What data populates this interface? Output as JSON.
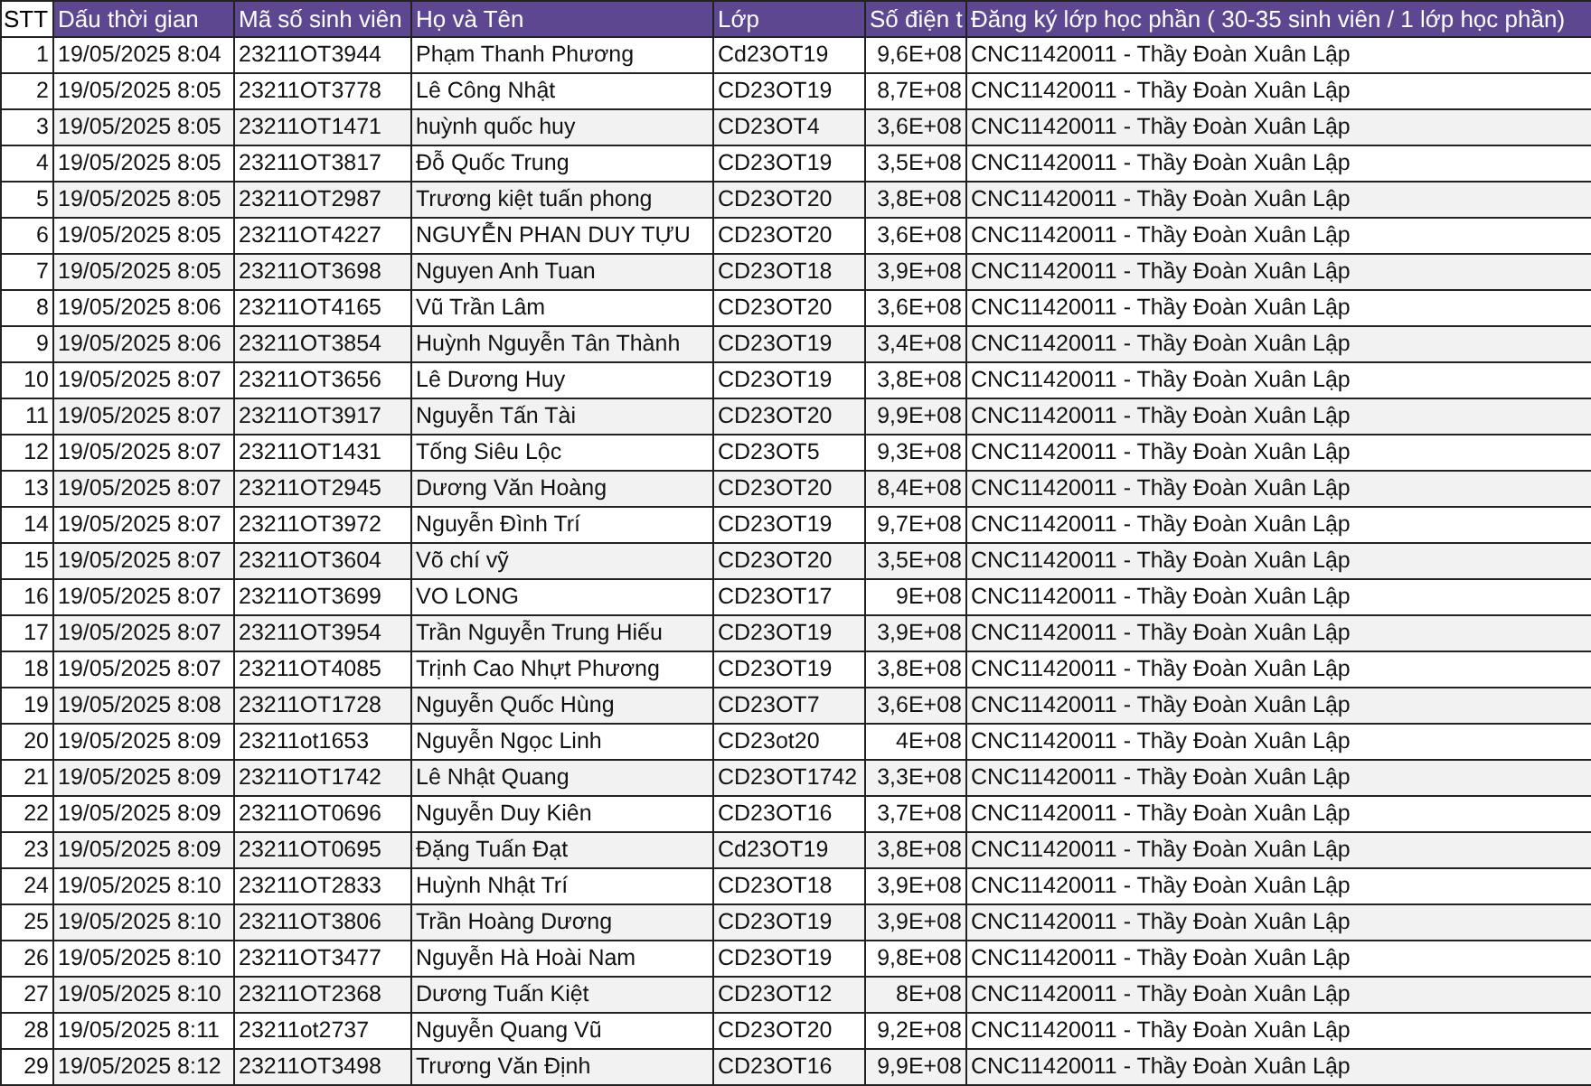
{
  "table": {
    "columns": [
      "STT",
      "Dấu thời gian",
      "Mã số sinh viên",
      "Họ và Tên",
      "Lớp",
      "Số điện t",
      "Đăng ký lớp học phần ( 30-35 sinh viên / 1 lớp học phần)"
    ],
    "rows": [
      [
        "1",
        "19/05/2025 8:04",
        "23211OT3944",
        "Phạm Thanh Phương",
        "Cd23OT19",
        "9,6E+08",
        "CNC11420011 - Thầy Đoàn Xuân Lập"
      ],
      [
        "2",
        "19/05/2025 8:05",
        "23211OT3778",
        "Lê Công Nhật",
        "CD23OT19",
        "8,7E+08",
        "CNC11420011 - Thầy Đoàn Xuân Lập"
      ],
      [
        "3",
        "19/05/2025 8:05",
        "23211OT1471",
        "huỳnh quốc huy",
        "CD23OT4",
        "3,6E+08",
        "CNC11420011 - Thầy Đoàn Xuân Lập"
      ],
      [
        "4",
        "19/05/2025 8:05",
        "23211OT3817",
        "Đỗ Quốc Trung",
        "CD23OT19",
        "3,5E+08",
        "CNC11420011 - Thầy Đoàn Xuân Lập"
      ],
      [
        "5",
        "19/05/2025 8:05",
        "23211OT2987",
        "Trương kiệt tuấn phong",
        "CD23OT20",
        "3,8E+08",
        "CNC11420011 - Thầy Đoàn Xuân Lập"
      ],
      [
        "6",
        "19/05/2025 8:05",
        "23211OT4227",
        "NGUYỄN PHAN DUY TỰU",
        "CD23OT20",
        "3,6E+08",
        "CNC11420011 - Thầy Đoàn Xuân Lập"
      ],
      [
        "7",
        "19/05/2025 8:05",
        "23211OT3698",
        "Nguyen Anh Tuan",
        "CD23OT18",
        "3,9E+08",
        "CNC11420011 - Thầy Đoàn Xuân Lập"
      ],
      [
        "8",
        "19/05/2025 8:06",
        "23211OT4165",
        "Vũ Trần Lâm",
        "CD23OT20",
        "3,6E+08",
        "CNC11420011 - Thầy Đoàn Xuân Lập"
      ],
      [
        "9",
        "19/05/2025 8:06",
        "23211OT3854",
        "Huỳnh Nguyễn Tân Thành",
        "CD23OT19",
        "3,4E+08",
        "CNC11420011 - Thầy Đoàn Xuân Lập"
      ],
      [
        "10",
        "19/05/2025 8:07",
        "23211OT3656",
        "Lê Dương Huy",
        "CD23OT19",
        "3,8E+08",
        "CNC11420011 - Thầy Đoàn Xuân Lập"
      ],
      [
        "11",
        "19/05/2025 8:07",
        "23211OT3917",
        "Nguyễn Tấn Tài",
        "CD23OT20",
        "9,9E+08",
        "CNC11420011 - Thầy Đoàn Xuân Lập"
      ],
      [
        "12",
        "19/05/2025 8:07",
        "23211OT1431",
        "Tống Siêu Lộc",
        "CD23OT5",
        "9,3E+08",
        "CNC11420011 - Thầy Đoàn Xuân Lập"
      ],
      [
        "13",
        "19/05/2025 8:07",
        "23211OT2945",
        "Dương Văn Hoàng",
        "CD23OT20",
        "8,4E+08",
        "CNC11420011 - Thầy Đoàn Xuân Lập"
      ],
      [
        "14",
        "19/05/2025 8:07",
        "23211OT3972",
        "Nguyễn Đình Trí",
        "CD23OT19",
        "9,7E+08",
        "CNC11420011 - Thầy Đoàn Xuân Lập"
      ],
      [
        "15",
        "19/05/2025 8:07",
        "23211OT3604",
        "Võ chí vỹ",
        "CD23OT20",
        "3,5E+08",
        "CNC11420011 - Thầy Đoàn Xuân Lập"
      ],
      [
        "16",
        "19/05/2025 8:07",
        "23211OT3699",
        "VO LONG",
        "CD23OT17",
        "9E+08",
        "CNC11420011 - Thầy Đoàn Xuân Lập"
      ],
      [
        "17",
        "19/05/2025 8:07",
        "23211OT3954",
        "Trần Nguyễn Trung Hiếu",
        "CD23OT19",
        "3,9E+08",
        "CNC11420011 - Thầy Đoàn Xuân Lập"
      ],
      [
        "18",
        "19/05/2025 8:07",
        "23211OT4085",
        "Trịnh Cao Nhựt Phương",
        "CD23OT19",
        "3,8E+08",
        "CNC11420011 - Thầy Đoàn Xuân Lập"
      ],
      [
        "19",
        "19/05/2025 8:08",
        "23211OT1728",
        "Nguyễn Quốc Hùng",
        "CD23OT7",
        "3,6E+08",
        "CNC11420011 - Thầy Đoàn Xuân Lập"
      ],
      [
        "20",
        "19/05/2025 8:09",
        "23211ot1653",
        "Nguyễn Ngọc Linh",
        "CD23ot20",
        "4E+08",
        "CNC11420011 - Thầy Đoàn Xuân Lập"
      ],
      [
        "21",
        "19/05/2025 8:09",
        "23211OT1742",
        "Lê Nhật Quang",
        "CD23OT1742",
        "3,3E+08",
        "CNC11420011 - Thầy Đoàn Xuân Lập"
      ],
      [
        "22",
        "19/05/2025 8:09",
        "23211OT0696",
        "Nguyễn Duy Kiên",
        "CD23OT16",
        "3,7E+08",
        "CNC11420011 - Thầy Đoàn Xuân Lập"
      ],
      [
        "23",
        "19/05/2025 8:09",
        "23211OT0695",
        "Đặng Tuấn Đạt",
        "Cd23OT19",
        "3,8E+08",
        "CNC11420011 - Thầy Đoàn Xuân Lập"
      ],
      [
        "24",
        "19/05/2025 8:10",
        "23211OT2833",
        "Huỳnh Nhật Trí",
        "CD23OT18",
        "3,9E+08",
        "CNC11420011 - Thầy Đoàn Xuân Lập"
      ],
      [
        "25",
        "19/05/2025 8:10",
        "23211OT3806",
        "Trần Hoàng Dương",
        "CD23OT19",
        "3,9E+08",
        "CNC11420011 - Thầy Đoàn Xuân Lập"
      ],
      [
        "26",
        "19/05/2025 8:10",
        "23211OT3477",
        "Nguyễn Hà Hoài Nam",
        "CD23OT19",
        "9,8E+08",
        "CNC11420011 - Thầy Đoàn Xuân Lập"
      ],
      [
        "27",
        "19/05/2025 8:10",
        "23211OT2368",
        "Dương Tuấn Kiệt",
        "CD23OT12",
        "8E+08",
        "CNC11420011 - Thầy Đoàn Xuân Lập"
      ],
      [
        "28",
        "19/05/2025 8:11",
        "23211ot2737",
        "Nguyễn Quang Vũ",
        "CD23OT20",
        "9,2E+08",
        "CNC11420011 - Thầy Đoàn Xuân Lập"
      ],
      [
        "29",
        "19/05/2025 8:12",
        "23211OT3498",
        "Trương Văn Định",
        "CD23OT16",
        "9,9E+08",
        "CNC11420011 - Thầy Đoàn Xuân Lập"
      ]
    ]
  }
}
